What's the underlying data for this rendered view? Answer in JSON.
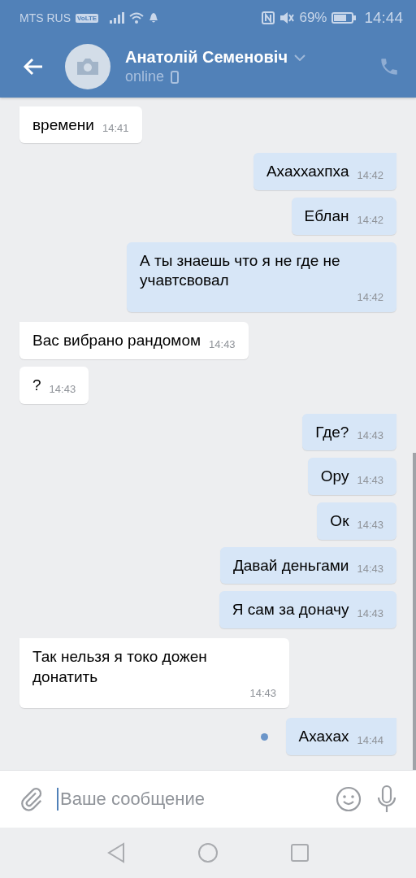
{
  "status_bar": {
    "carrier": "MTS RUS",
    "volte": "VoLTE",
    "battery": "69%",
    "time": "14:44"
  },
  "header": {
    "name": "Анатолій Семеновіч",
    "status": "online"
  },
  "messages": [
    {
      "outgoing": false,
      "text": "времени",
      "time": "14:41",
      "unread": false
    },
    {
      "outgoing": true,
      "text": "Ахаххахпха",
      "time": "14:42",
      "unread": false
    },
    {
      "outgoing": true,
      "text": "Еблан",
      "time": "14:42",
      "unread": false
    },
    {
      "outgoing": true,
      "text": "А ты знаешь что я не где не учавтсвовал",
      "time": "14:42",
      "unread": false
    },
    {
      "outgoing": false,
      "text": "Вас вибрано рандомом",
      "time": "14:43",
      "unread": false
    },
    {
      "outgoing": false,
      "text": "?",
      "time": "14:43",
      "unread": false
    },
    {
      "outgoing": true,
      "text": "Где?",
      "time": "14:43",
      "unread": false
    },
    {
      "outgoing": true,
      "text": "Ору",
      "time": "14:43",
      "unread": false
    },
    {
      "outgoing": true,
      "text": "Ок",
      "time": "14:43",
      "unread": false
    },
    {
      "outgoing": true,
      "text": "Давай деньгами",
      "time": "14:43",
      "unread": false
    },
    {
      "outgoing": true,
      "text": "Я сам за доначу",
      "time": "14:43",
      "unread": false
    },
    {
      "outgoing": false,
      "text": "Так нельзя я токо дожен донатить",
      "time": "14:43",
      "unread": false
    },
    {
      "outgoing": true,
      "text": "Ахахах",
      "time": "14:44",
      "unread": true
    }
  ],
  "composer": {
    "placeholder": "Ваше сообщение"
  }
}
